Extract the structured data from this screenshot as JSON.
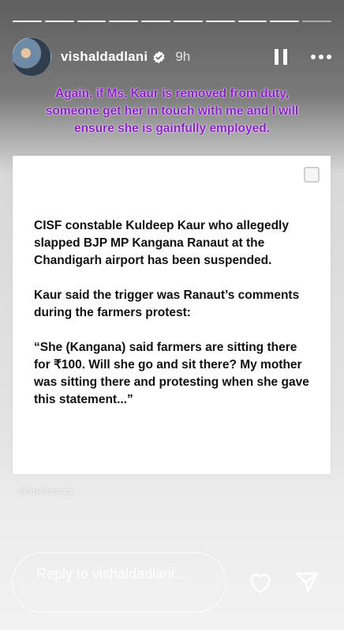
{
  "story": {
    "segments_total": 10,
    "segments_viewed": 9,
    "username": "vishaldadlani",
    "time_ago": "9h",
    "caption_lines": [
      "Again, if Ms. Kaur is removed from duty,",
      "someone get her in touch with me and I will",
      "ensure she is gainfully employed."
    ],
    "post_paragraphs": [
      "CISF constable Kuldeep Kaur who allegedly slapped BJP MP Kangana Ranaut at the Chandigarh airport has been suspended.",
      "Kaur said the trigger was Ranaut’s comments during the farmers protest:",
      "“She (Kangana) said farmers are sitting there for ₹100. Will she go and sit there? My mother was sitting there and protesting when she gave this statement...”"
    ],
    "watermark": "@fayedsouza"
  },
  "footer": {
    "reply_placeholder": "Reply to vishaldadlani..."
  },
  "icons": {
    "verified": "verified-badge-icon",
    "pause": "pause-icon",
    "more": "more-icon",
    "heart": "heart-icon",
    "send": "send-icon"
  },
  "colors": {
    "caption": "#8b1ec9",
    "verified": "#3897f0"
  }
}
